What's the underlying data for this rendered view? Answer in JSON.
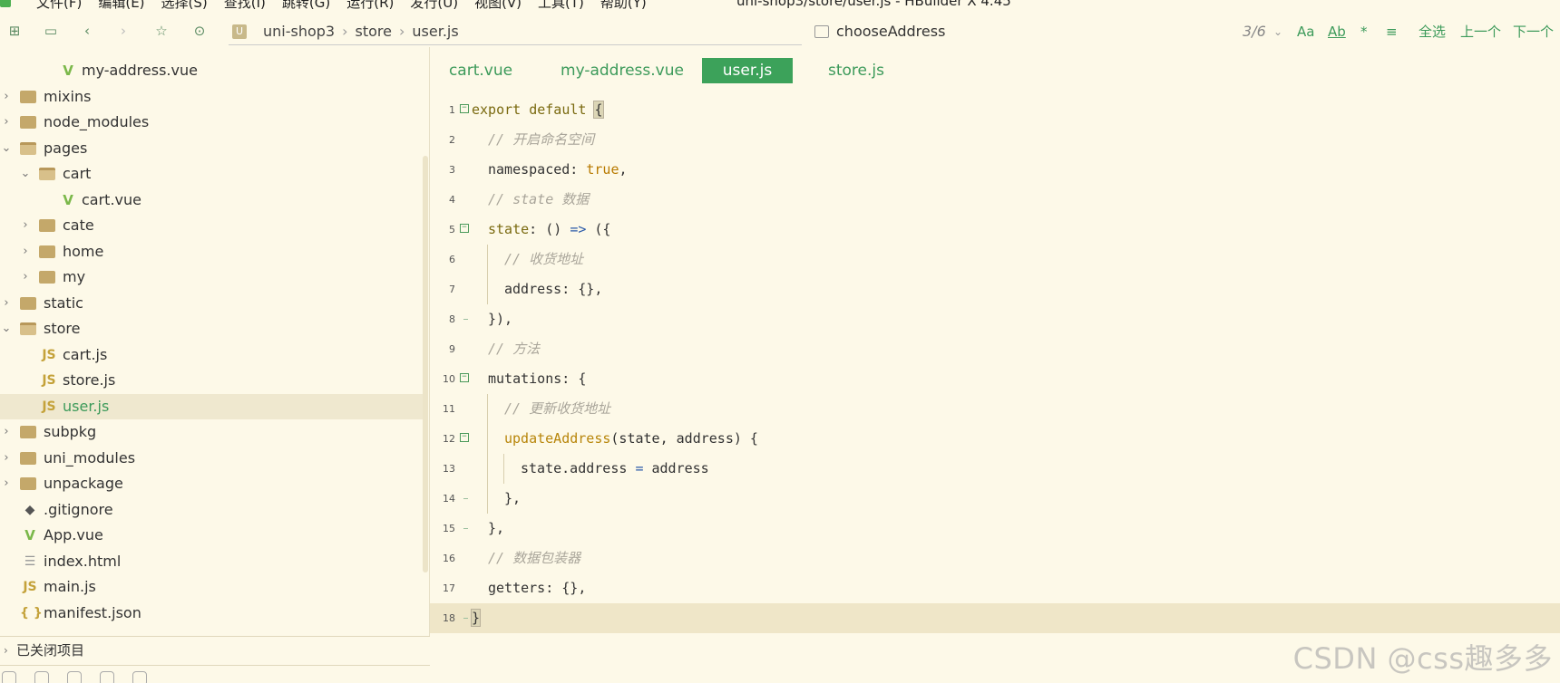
{
  "menubar": {
    "items": [
      "文件(F)",
      "编辑(E)",
      "选择(S)",
      "查找(I)",
      "跳转(G)",
      "运行(R)",
      "发行(U)",
      "视图(V)",
      "工具(T)",
      "帮助(Y)"
    ],
    "window_title": "uni-shop3/store/user.js - HBuilder X 4.45"
  },
  "toolbar": {
    "icons": [
      "new-file-icon",
      "save-icon",
      "back-icon",
      "forward-icon",
      "star-icon",
      "run-icon"
    ],
    "breadcrumb": [
      "uni-shop3",
      "store",
      "user.js"
    ],
    "search": {
      "value": "chooseAddress",
      "match_count": "3/6",
      "options": [
        "Aa",
        "Ab",
        "*",
        "≡",
        "全选",
        "上一个",
        "下一个"
      ]
    }
  },
  "sidebar": {
    "tree": [
      {
        "label": "my-address.vue",
        "type": "vue",
        "depth": 3,
        "expanded": null
      },
      {
        "label": "mixins",
        "type": "folder",
        "depth": 1,
        "expanded": false
      },
      {
        "label": "node_modules",
        "type": "folder",
        "depth": 1,
        "expanded": false
      },
      {
        "label": "pages",
        "type": "folder",
        "depth": 1,
        "expanded": true
      },
      {
        "label": "cart",
        "type": "folder",
        "depth": 2,
        "expanded": true
      },
      {
        "label": "cart.vue",
        "type": "vue",
        "depth": 3,
        "expanded": null
      },
      {
        "label": "cate",
        "type": "folder",
        "depth": 2,
        "expanded": false
      },
      {
        "label": "home",
        "type": "folder",
        "depth": 2,
        "expanded": false
      },
      {
        "label": "my",
        "type": "folder",
        "depth": 2,
        "expanded": false
      },
      {
        "label": "static",
        "type": "folder",
        "depth": 1,
        "expanded": false
      },
      {
        "label": "store",
        "type": "folder",
        "depth": 1,
        "expanded": true
      },
      {
        "label": "cart.js",
        "type": "js",
        "depth": 2,
        "expanded": null
      },
      {
        "label": "store.js",
        "type": "js",
        "depth": 2,
        "expanded": null
      },
      {
        "label": "user.js",
        "type": "js",
        "depth": 2,
        "expanded": null,
        "selected": true
      },
      {
        "label": "subpkg",
        "type": "folder",
        "depth": 1,
        "expanded": false
      },
      {
        "label": "uni_modules",
        "type": "folder",
        "depth": 1,
        "expanded": false
      },
      {
        "label": "unpackage",
        "type": "folder",
        "depth": 1,
        "expanded": false
      },
      {
        "label": ".gitignore",
        "type": "git",
        "depth": 1,
        "expanded": null
      },
      {
        "label": "App.vue",
        "type": "vue",
        "depth": 1,
        "expanded": null
      },
      {
        "label": "index.html",
        "type": "html",
        "depth": 1,
        "expanded": null
      },
      {
        "label": "main.js",
        "type": "js",
        "depth": 1,
        "expanded": null
      },
      {
        "label": "manifest.json",
        "type": "json",
        "depth": 1,
        "expanded": null
      }
    ],
    "closed_projects_label": "已关闭项目"
  },
  "editor": {
    "tabs": [
      {
        "label": "cart.vue",
        "active": false
      },
      {
        "label": "my-address.vue",
        "active": false
      },
      {
        "label": "user.js",
        "active": true
      },
      {
        "label": "store.js",
        "active": false
      }
    ],
    "current_line": 18,
    "lines": [
      {
        "n": "1",
        "indent": 0,
        "fold": "open",
        "tokens": [
          [
            "kw",
            "export default "
          ],
          [
            "hl",
            "{"
          ]
        ]
      },
      {
        "n": "2",
        "indent": 1,
        "fold": null,
        "tokens": [
          [
            "cm",
            "// 开启命名空间"
          ]
        ]
      },
      {
        "n": "3",
        "indent": 1,
        "fold": null,
        "tokens": [
          [
            "pl",
            "namespaced: "
          ],
          [
            "bool",
            "true"
          ],
          [
            "pl",
            ","
          ]
        ]
      },
      {
        "n": "4",
        "indent": 1,
        "fold": null,
        "tokens": [
          [
            "cm",
            "// state 数据"
          ]
        ]
      },
      {
        "n": "5",
        "indent": 1,
        "fold": "open",
        "tokens": [
          [
            "kw",
            "state"
          ],
          [
            "pl",
            ": () "
          ],
          [
            "arrow",
            "=>"
          ],
          [
            "pl",
            " ({"
          ]
        ]
      },
      {
        "n": "6",
        "indent": 2,
        "fold": null,
        "tokens": [
          [
            "cm",
            "// 收货地址"
          ]
        ]
      },
      {
        "n": "7",
        "indent": 2,
        "fold": null,
        "tokens": [
          [
            "pl",
            "address: {},"
          ]
        ]
      },
      {
        "n": "8",
        "indent": 1,
        "fold": "end",
        "tokens": [
          [
            "pl",
            "}),"
          ]
        ]
      },
      {
        "n": "9",
        "indent": 1,
        "fold": null,
        "tokens": [
          [
            "cm",
            "// 方法"
          ]
        ]
      },
      {
        "n": "10",
        "indent": 1,
        "fold": "open",
        "tokens": [
          [
            "pl",
            "mutations: {"
          ]
        ]
      },
      {
        "n": "11",
        "indent": 2,
        "fold": null,
        "tokens": [
          [
            "cm",
            "// 更新收货地址"
          ]
        ]
      },
      {
        "n": "12",
        "indent": 2,
        "fold": "open",
        "tokens": [
          [
            "fn",
            "updateAddress"
          ],
          [
            "pl",
            "(state, address) {"
          ]
        ]
      },
      {
        "n": "13",
        "indent": 3,
        "fold": null,
        "tokens": [
          [
            "pl",
            "state.address "
          ],
          [
            "arrow",
            "="
          ],
          [
            "pl",
            " address"
          ]
        ]
      },
      {
        "n": "14",
        "indent": 2,
        "fold": "end",
        "tokens": [
          [
            "pl",
            "},"
          ]
        ]
      },
      {
        "n": "15",
        "indent": 1,
        "fold": "end",
        "tokens": [
          [
            "pl",
            "},"
          ]
        ]
      },
      {
        "n": "16",
        "indent": 1,
        "fold": null,
        "tokens": [
          [
            "cm",
            "// 数据包装器"
          ]
        ]
      },
      {
        "n": "17",
        "indent": 1,
        "fold": null,
        "tokens": [
          [
            "pl",
            "getters: {},"
          ]
        ]
      },
      {
        "n": "18",
        "indent": 0,
        "fold": "end",
        "tokens": [
          [
            "hl",
            "}"
          ]
        ]
      }
    ]
  },
  "watermark": "CSDN @css趣多多",
  "colors": {
    "background": "#fdf9e8",
    "accent_green": "#3ca25a",
    "comment": "#a9a59a",
    "keyword": "#7a6a10"
  }
}
